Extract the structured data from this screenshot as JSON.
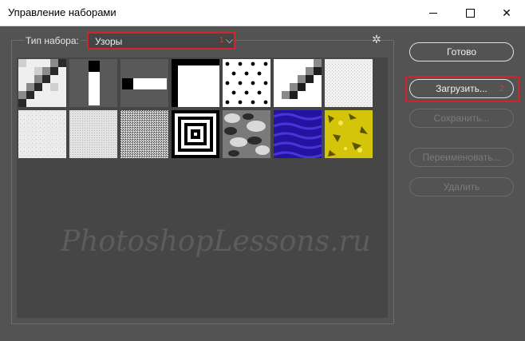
{
  "window": {
    "title": "Управление наборами"
  },
  "preset_type": {
    "label": "Тип набора:",
    "value": "Узоры",
    "marker": "1"
  },
  "buttons": {
    "done": "Готово",
    "load": "Загрузить...",
    "load_marker": "2",
    "save": "Сохранить...",
    "rename": "Переименовать...",
    "delete": "Удалить"
  },
  "patterns": [
    "Diagonal pattern 1",
    "Vertical bar",
    "Horizontal bar",
    "Frame square",
    "Polka dots",
    "Diagonal pattern 2",
    "Light noise 1",
    "Light noise 2",
    "Light noise 3",
    "Dense noise",
    "Concentric squares",
    "Gray camouflage",
    "Blue waves",
    "Yellow gold"
  ],
  "watermark": "PhotoshopLessons.ru",
  "colors": {
    "accent": "#d2232a",
    "panel": "#535353",
    "grid": "#464646"
  }
}
